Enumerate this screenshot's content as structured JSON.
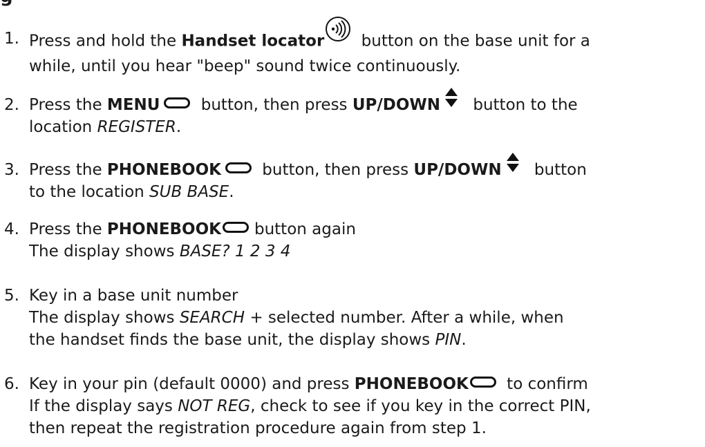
{
  "heading_fragment": "g",
  "icons": {
    "handset_locator": "handset-locator-icon",
    "menu_key": "oval-key-icon",
    "up_down": "up-down-arrow-icon"
  },
  "steps": [
    {
      "number": "1.",
      "t1": "Press and hold the ",
      "b1": "Handset locator",
      "t2": " button on the base unit for a",
      "l2": "while, until you hear \"beep\" sound twice continuously."
    },
    {
      "number": "2.",
      "t1": "Press the ",
      "b1": "MENU",
      "t2": " button, then press ",
      "b2": "UP/DOWN",
      "t3": " button to the",
      "l2a": "location ",
      "l2i": "REGISTER",
      "l2b": "."
    },
    {
      "number": "3.",
      "t1": "Press the ",
      "b1": "PHONEBOOK",
      "t2": " button, then press ",
      "b2": "UP/DOWN",
      "t3": " button",
      "l2a": "to the location ",
      "l2i": "SUB BASE",
      "l2b": "."
    },
    {
      "number": "4.",
      "t1": "Press the ",
      "b1": "PHONEBOOK",
      "t2": "button again",
      "l2a": "The display shows ",
      "l2i": "BASE? 1 2 3 4"
    },
    {
      "number": "5.",
      "t1": "Key in a base unit number",
      "l2a": "The display shows ",
      "l2i": "SEARCH",
      "l2b": " + selected number. After a while, when",
      "l3a": "the handset finds the base unit, the display shows ",
      "l3i": "PIN",
      "l3b": "."
    },
    {
      "number": "6.",
      "t1": "Key in your pin (default 0000) and press ",
      "b1": "PHONEBOOK",
      "t2": " to confirm",
      "l2a": "If the display says ",
      "l2i": "NOT REG",
      "l2b": ", check to see if you key in the correct PIN,",
      "l3": "then repeat the registration procedure again from step 1."
    }
  ]
}
